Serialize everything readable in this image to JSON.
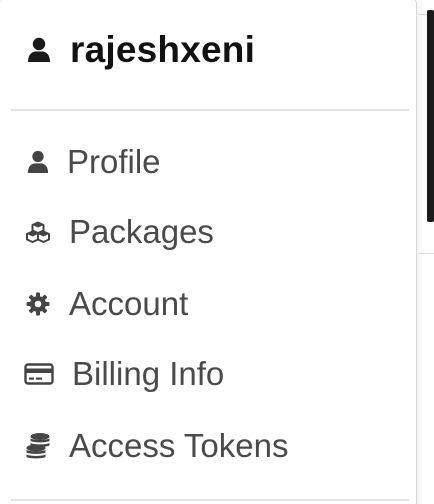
{
  "menu": {
    "username": "rajeshxeni",
    "header_icon": "user-icon",
    "items": [
      {
        "label": "Profile",
        "icon": "user-icon"
      },
      {
        "label": "Packages",
        "icon": "cubes-icon"
      },
      {
        "label": "Account",
        "icon": "gear-icon"
      },
      {
        "label": "Billing Info",
        "icon": "credit-card-icon"
      },
      {
        "label": "Access Tokens",
        "icon": "coins-icon"
      }
    ]
  },
  "colors": {
    "username_text": "#111111",
    "item_text": "#4a4a4a",
    "icon": "#444444",
    "divider": "#e3e3e3"
  }
}
